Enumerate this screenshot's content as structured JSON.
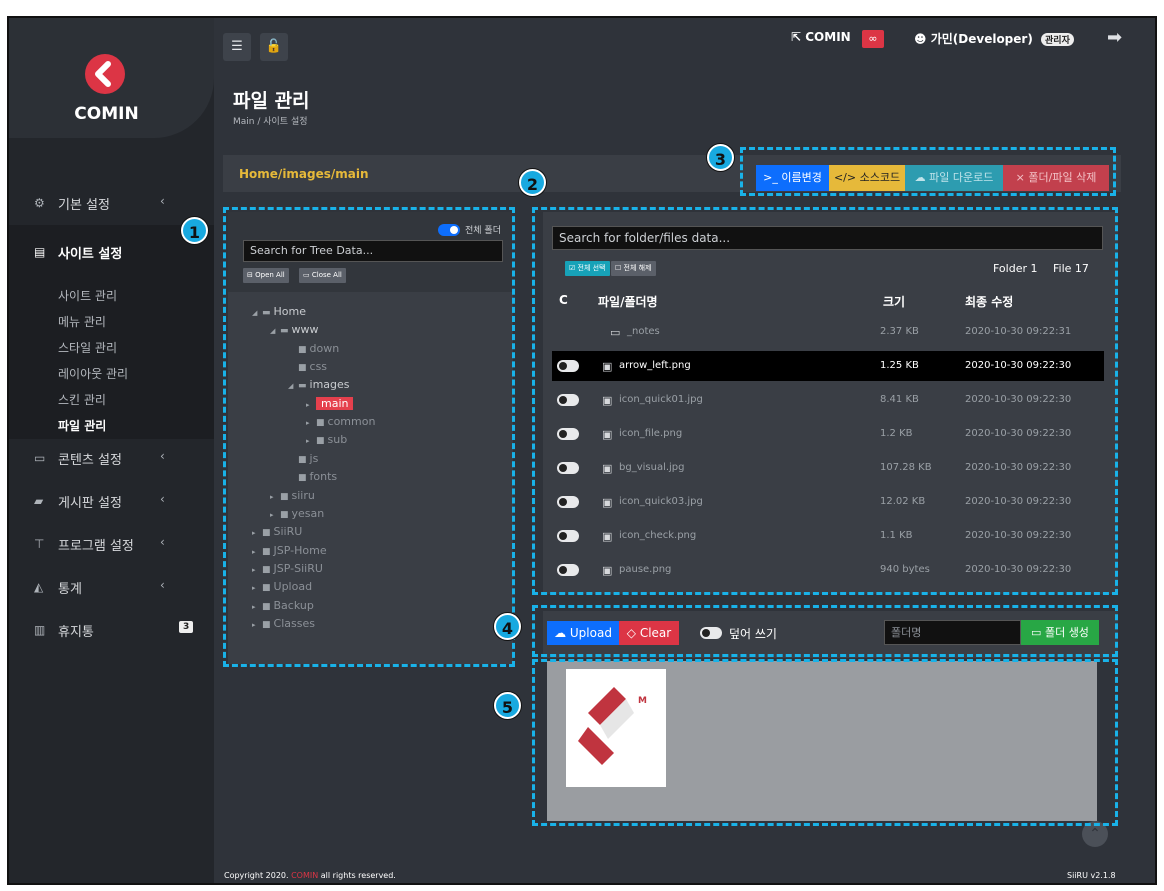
{
  "brand": {
    "name": "COMIN"
  },
  "sidebar": {
    "items": [
      {
        "label": "기본 설정",
        "icon": "gears-icon",
        "chevron": "‹"
      },
      {
        "label": "사이트 설정",
        "icon": "server-icon"
      },
      {
        "label": "콘텐츠 설정",
        "icon": "window-icon",
        "chevron": "‹"
      },
      {
        "label": "게시판 설정",
        "icon": "chat-icon",
        "chevron": "‹"
      },
      {
        "label": "프로그램 설정",
        "icon": "sitemap-icon",
        "chevron": "‹"
      },
      {
        "label": "통계",
        "icon": "area-chart-icon",
        "chevron": "‹"
      },
      {
        "label": "휴지통",
        "icon": "trash-icon",
        "badge": "3"
      }
    ],
    "sub_items": [
      "사이트 관리",
      "메뉴 관리",
      "스타일 관리",
      "레이아웃 관리",
      "스킨 관리",
      "파일 관리"
    ]
  },
  "header": {
    "comin_link": "COMIN",
    "user": "가민(Developer)",
    "role": "관리자"
  },
  "page": {
    "title": "파일 관리",
    "breadcrumb": "Main  /  사이트 설정"
  },
  "path": "Home/images/main",
  "actions": {
    "rename": "이름변경",
    "source": "소스코드",
    "download": "파일 다운로드",
    "delete": "폴더/파일 삭제"
  },
  "markers": [
    "1",
    "2",
    "3",
    "4",
    "5"
  ],
  "tree": {
    "toggle_label": "전체 폴더",
    "search_placeholder": "Search for Tree Data...",
    "open_all": "Open All",
    "close_all": "Close All",
    "nodes": [
      {
        "label": "Home",
        "open": true
      },
      {
        "label": "www",
        "open": true
      },
      {
        "label": "down"
      },
      {
        "label": "css"
      },
      {
        "label": "images",
        "open": true
      },
      {
        "label": "main",
        "selected": true
      },
      {
        "label": "common"
      },
      {
        "label": "sub"
      },
      {
        "label": "js"
      },
      {
        "label": "fonts"
      },
      {
        "label": "siiru"
      },
      {
        "label": "yesan"
      },
      {
        "label": "SiiRU"
      },
      {
        "label": "JSP-Home"
      },
      {
        "label": "JSP-SiiRU"
      },
      {
        "label": "Upload"
      },
      {
        "label": "Backup"
      },
      {
        "label": "Classes"
      }
    ]
  },
  "files": {
    "search_placeholder": "Search for folder/files data...",
    "select_all": "전체 선택",
    "deselect_all": "전체 해제",
    "folder_count": "Folder 1",
    "file_count": "File 17",
    "columns": [
      "C",
      "파일/폴더명",
      "크기",
      "최종 수정"
    ],
    "rows": [
      {
        "name": "_notes",
        "size": "2.37 KB",
        "date": "2020-10-30 09:22:31",
        "folder": true
      },
      {
        "name": "arrow_left.png",
        "size": "1.25 KB",
        "date": "2020-10-30 09:22:30",
        "highlight": true
      },
      {
        "name": "icon_quick01.jpg",
        "size": "8.41 KB",
        "date": "2020-10-30 09:22:30"
      },
      {
        "name": "icon_file.png",
        "size": "1.2 KB",
        "date": "2020-10-30 09:22:30"
      },
      {
        "name": "bg_visual.jpg",
        "size": "107.28 KB",
        "date": "2020-10-30 09:22:30"
      },
      {
        "name": "icon_quick03.jpg",
        "size": "12.02 KB",
        "date": "2020-10-30 09:22:30"
      },
      {
        "name": "icon_check.png",
        "size": "1.1 KB",
        "date": "2020-10-30 09:22:30"
      },
      {
        "name": "pause.png",
        "size": "940 bytes",
        "date": "2020-10-30 09:22:30"
      }
    ]
  },
  "upload": {
    "upload": "Upload",
    "clear": "Clear",
    "overwrite": "덮어 쓰기",
    "folder_placeholder": "폴더명",
    "create_folder": "폴더 생성"
  },
  "preview": {
    "logo_letter": "M"
  },
  "footer": {
    "prefix": "Copyright 2020. ",
    "brand": "COMIN",
    "suffix": " all rights reserved.",
    "version": "SiiRU v2.1.8"
  },
  "colors": {
    "accent_blue": "#0d6efd",
    "danger": "#dc3545",
    "warning": "#e6b93a",
    "success": "#28a745",
    "marker": "#18a9e0"
  }
}
